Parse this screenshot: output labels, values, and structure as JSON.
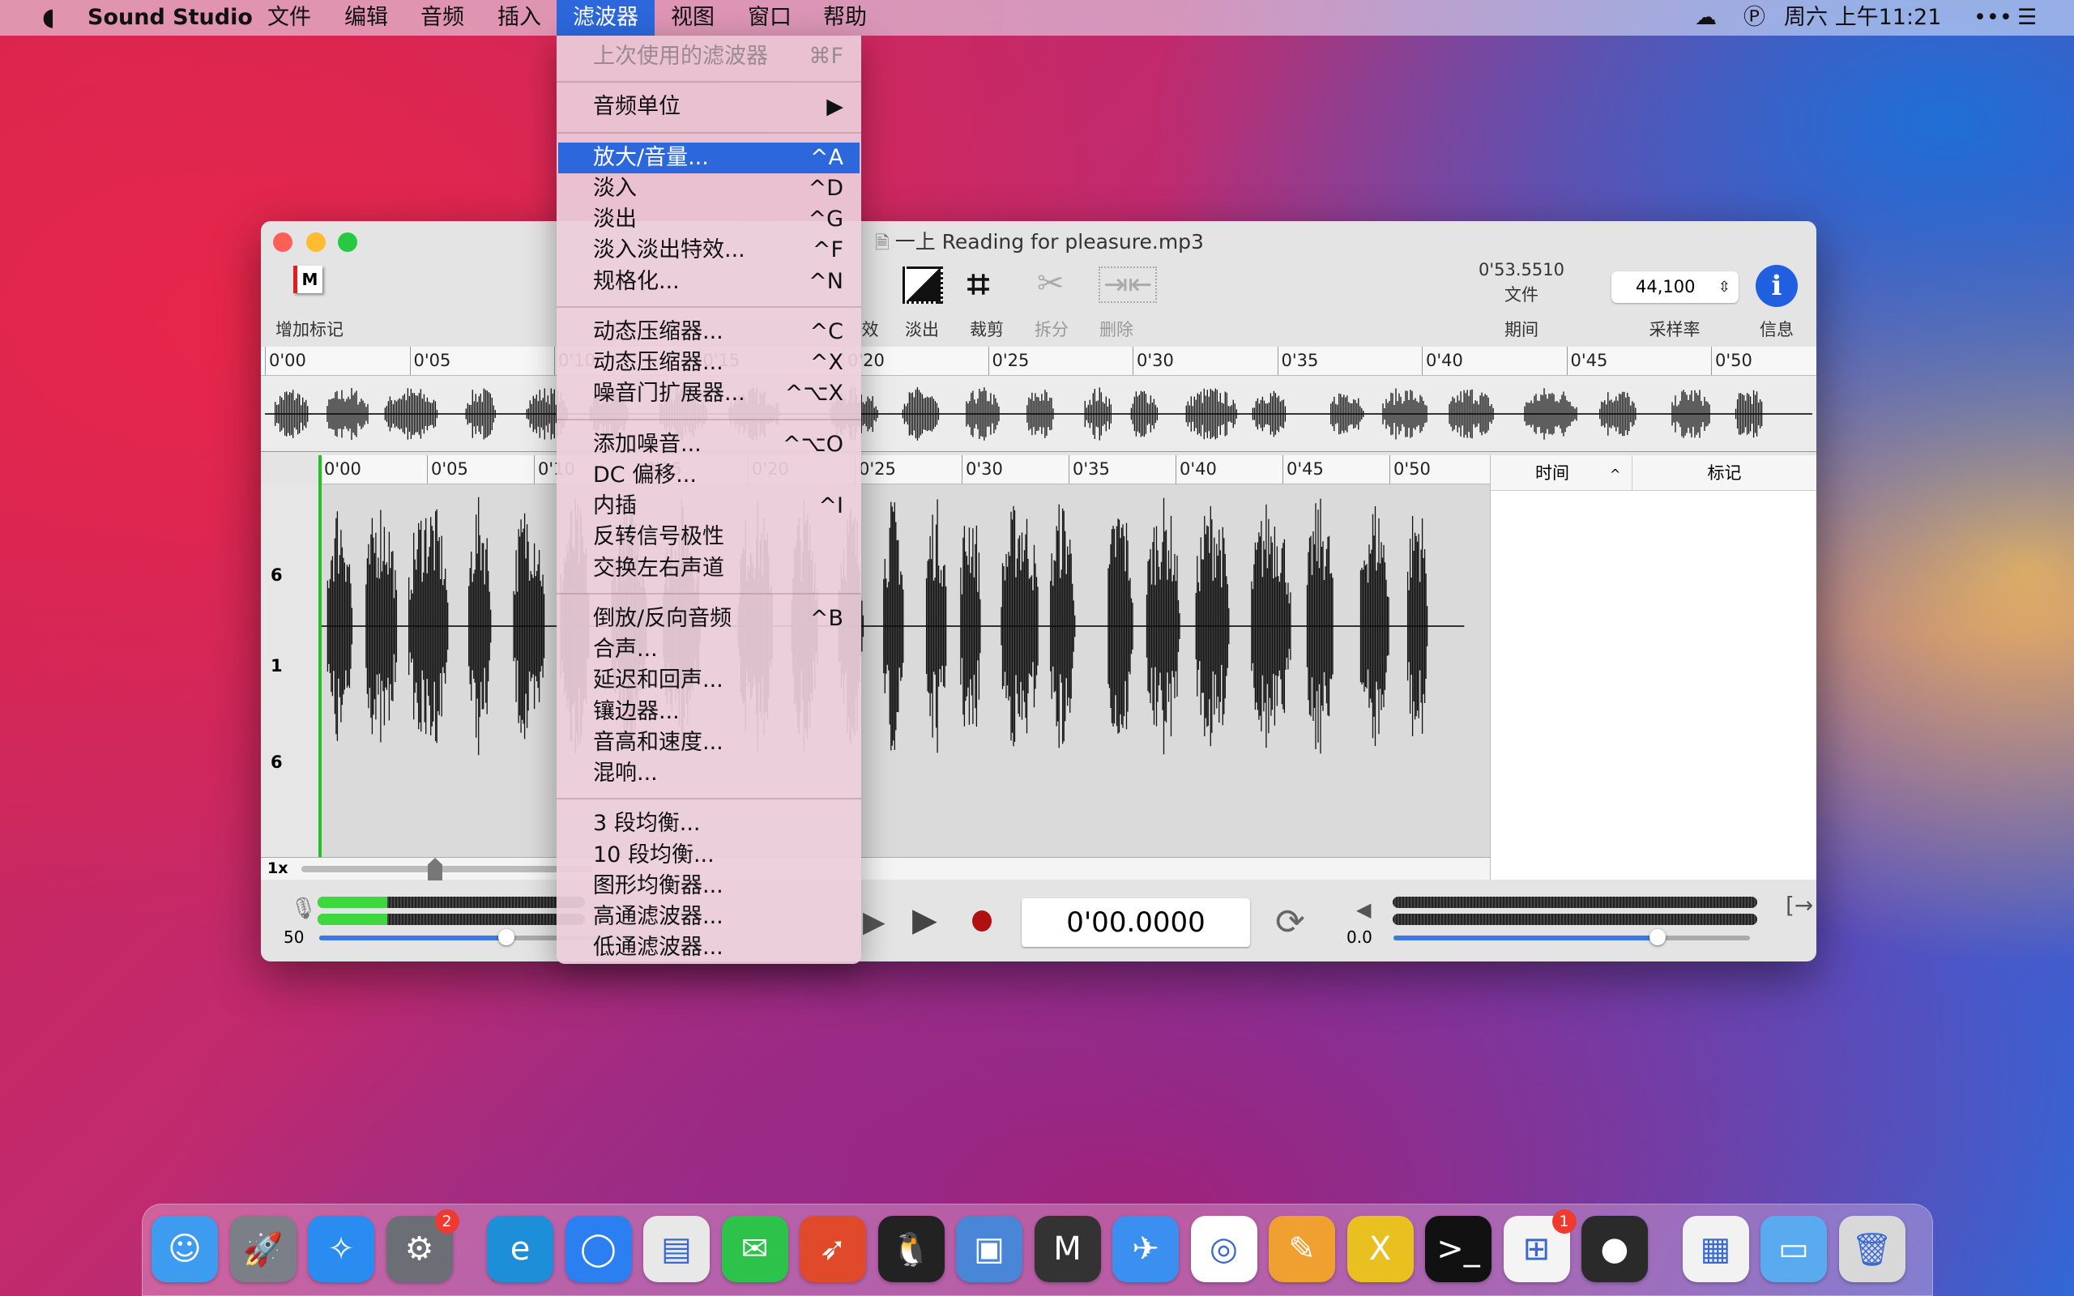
{
  "menubar": {
    "app": "Sound Studio",
    "items": [
      "文件",
      "编辑",
      "音频",
      "插入",
      "滤波器",
      "视图",
      "窗口",
      "帮助"
    ],
    "active": "滤波器",
    "clock": "周六 上午11:21"
  },
  "window": {
    "title": "一上 Reading for pleasure.mp3",
    "toolbar": {
      "add_marker": "增加标记",
      "partial": "效",
      "fade_out": "淡出",
      "crop": "裁剪",
      "split": "拆分",
      "delete": "删除",
      "duration_value": "0'53.5510",
      "duration_sub": "文件",
      "duration_label": "期间",
      "sample_rate": "44,100",
      "sample_rate_label": "采样率",
      "info": "信息"
    },
    "overview_ticks": [
      "0'00",
      "0'05",
      "0'10",
      "0'15",
      "0'20",
      "0'25",
      "0'30",
      "0'35",
      "0'40",
      "0'45",
      "0'50"
    ],
    "main_ticks": [
      "0'00",
      "0'05",
      "0'10",
      "0'15",
      "0'20",
      "0'25",
      "0'30",
      "0'35",
      "0'40",
      "0'45",
      "0'50"
    ],
    "y_labels": [
      "6",
      "1",
      "6"
    ],
    "zoom": "1x",
    "markers_table": {
      "col_time": "时间",
      "col_marker": "标记"
    },
    "input_level": "50",
    "input_slider": 0.55,
    "time_display": "0'00.0000",
    "output_level": "0.0",
    "output_slider": 0.74
  },
  "filter_menu": [
    {
      "label": "上次使用的滤波器",
      "shortcut": "⌘F",
      "disabled": true
    },
    {
      "sep": true
    },
    {
      "label": "音频单位",
      "shortcut": "▶"
    },
    {
      "sep": true
    },
    {
      "label": "放大/音量...",
      "shortcut": "^A",
      "highlighted": true
    },
    {
      "label": "淡入",
      "shortcut": "^D"
    },
    {
      "label": "淡出",
      "shortcut": "^G"
    },
    {
      "label": "淡入淡出特效...",
      "shortcut": "^F"
    },
    {
      "label": "规格化...",
      "shortcut": "^N"
    },
    {
      "sep": true
    },
    {
      "label": "动态压缩器...",
      "shortcut": "^C"
    },
    {
      "label": "动态压缩器...",
      "shortcut": "^X"
    },
    {
      "label": "噪音门扩展器...",
      "shortcut": "^⌥X"
    },
    {
      "sep": true
    },
    {
      "label": "添加噪音...",
      "shortcut": "^⌥O"
    },
    {
      "label": "DC 偏移...",
      "shortcut": ""
    },
    {
      "label": "内插",
      "shortcut": "^I"
    },
    {
      "label": "反转信号极性",
      "shortcut": ""
    },
    {
      "label": "交换左右声道",
      "shortcut": ""
    },
    {
      "sep": true
    },
    {
      "label": "倒放/反向音频",
      "shortcut": "^B"
    },
    {
      "label": "合声...",
      "shortcut": ""
    },
    {
      "label": "延迟和回声...",
      "shortcut": ""
    },
    {
      "label": "镶边器...",
      "shortcut": ""
    },
    {
      "label": "音高和速度...",
      "shortcut": ""
    },
    {
      "label": "混响...",
      "shortcut": ""
    },
    {
      "sep": true
    },
    {
      "label": "3 段均衡...",
      "shortcut": ""
    },
    {
      "label": "10 段均衡...",
      "shortcut": ""
    },
    {
      "label": "图形均衡器...",
      "shortcut": ""
    },
    {
      "label": "高通滤波器...",
      "shortcut": ""
    },
    {
      "label": "低通滤波器...",
      "shortcut": ""
    }
  ],
  "dock": [
    {
      "name": "finder",
      "color": "#3d9bf0",
      "glyph": "☺"
    },
    {
      "name": "launchpad",
      "color": "#7a7f88",
      "glyph": "🚀"
    },
    {
      "name": "safari",
      "color": "#2a8cf0",
      "glyph": "✧"
    },
    {
      "name": "system-preferences",
      "color": "#6b6f75",
      "glyph": "⚙",
      "badge": "2"
    },
    {
      "sep": true
    },
    {
      "name": "edge",
      "color": "#1d8fd8",
      "glyph": "e"
    },
    {
      "name": "chat",
      "color": "#2b7ff0",
      "glyph": "◯"
    },
    {
      "name": "printer",
      "color": "#e8e8e8",
      "glyph": "▤"
    },
    {
      "name": "wechat",
      "color": "#2dc24a",
      "glyph": "✉"
    },
    {
      "name": "rocket",
      "color": "#e04a2a",
      "glyph": "➶"
    },
    {
      "name": "qq",
      "color": "#222",
      "glyph": "🐧"
    },
    {
      "name": "transmit",
      "color": "#4a86d8",
      "glyph": "▣"
    },
    {
      "name": "mweb",
      "color": "#333",
      "glyph": "M"
    },
    {
      "name": "mail-bird",
      "color": "#3a8ff0",
      "glyph": "✈"
    },
    {
      "name": "baidu-netdisk",
      "color": "#fff",
      "glyph": "◎"
    },
    {
      "name": "pixelmator",
      "color": "#f0a030",
      "glyph": "✎"
    },
    {
      "name": "x-app",
      "color": "#e8c020",
      "glyph": "X"
    },
    {
      "name": "terminal",
      "color": "#111",
      "glyph": ">_"
    },
    {
      "name": "office-installer",
      "color": "#f4f4f4",
      "glyph": "⊞",
      "badge": "1"
    },
    {
      "name": "sound-studio",
      "color": "#2a2a2a",
      "glyph": "●"
    },
    {
      "sep": true
    },
    {
      "name": "document",
      "color": "#f2f2f2",
      "glyph": "▦"
    },
    {
      "name": "folder",
      "color": "#5aaaf0",
      "glyph": "▭"
    },
    {
      "name": "trash",
      "color": "#d8d8d8",
      "glyph": "🗑"
    }
  ]
}
